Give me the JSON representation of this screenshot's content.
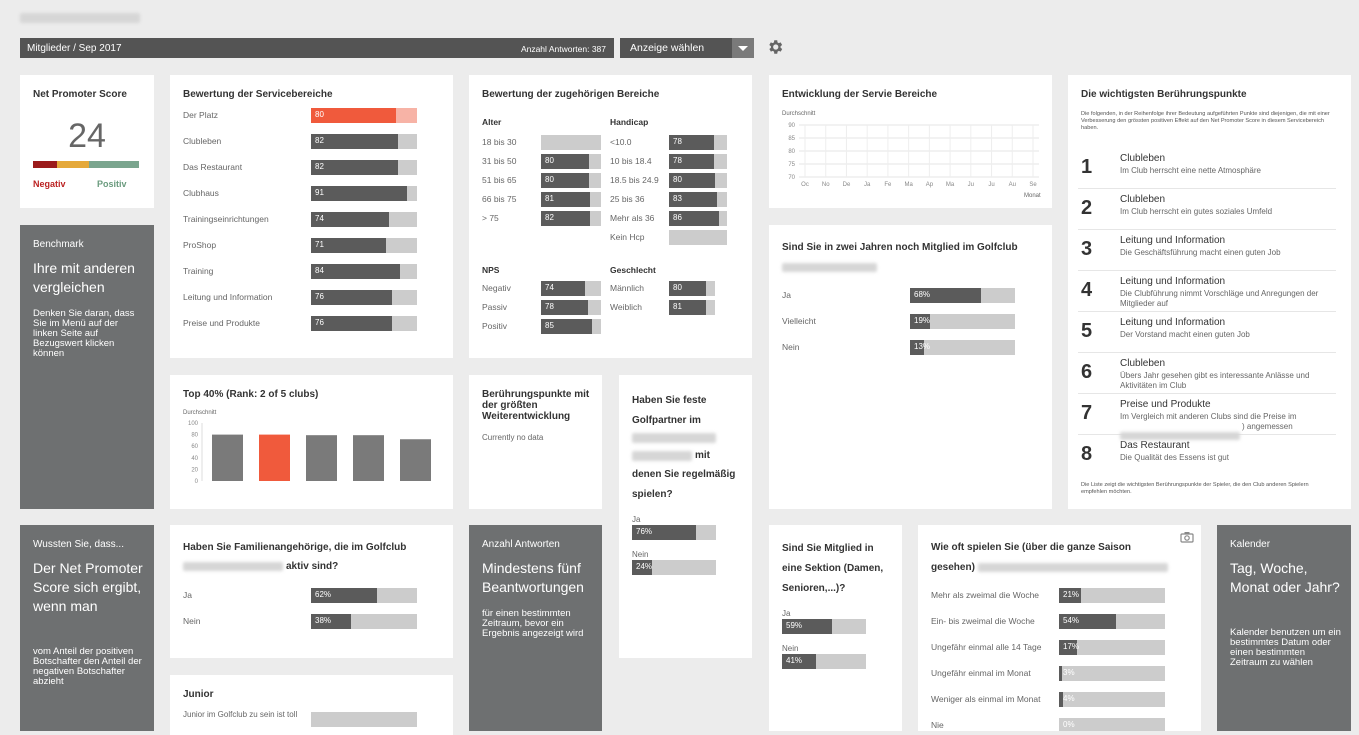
{
  "header": {
    "breadcrumb": "Mitglieder / Sep 2017",
    "answers": "Anzahl Antworten: 387",
    "select_label": "Anzeige wählen"
  },
  "nps": {
    "title": "Net Promoter Score",
    "value": "24",
    "neg": "Negativ",
    "pos": "Positiv"
  },
  "benchmark": {
    "title": "Benchmark",
    "headline": "Ihre mit anderen vergleichen",
    "text": "Denken Sie daran, dass Sie im Menü auf der linken Seite auf Bezugswert klicken können"
  },
  "service": {
    "title": "Bewertung der Servicebereiche",
    "items": [
      {
        "label": "Der Platz",
        "text": "80",
        "value": 80
      },
      {
        "label": "Clubleben",
        "text": "82",
        "value": 82
      },
      {
        "label": "Das Restaurant",
        "text": "82",
        "value": 82
      },
      {
        "label": "Clubhaus",
        "text": "91",
        "value": 91
      },
      {
        "label": "Trainingseinrichtungen",
        "text": "74",
        "value": 74
      },
      {
        "label": "ProShop",
        "text": "71",
        "value": 71
      },
      {
        "label": "Training",
        "text": "84",
        "value": 84
      },
      {
        "label": "Leitung und Information",
        "text": "76",
        "value": 76
      },
      {
        "label": "Preise und Produkte",
        "text": "76",
        "value": 76
      }
    ]
  },
  "related": {
    "title": "Bewertung der zugehörigen Bereiche",
    "alter_title": "Alter",
    "alter": [
      {
        "label": "18 bis 30",
        "text": "",
        "value": 0
      },
      {
        "label": "31 bis 50",
        "text": "80",
        "value": 80
      },
      {
        "label": "51 bis 65",
        "text": "80",
        "value": 80
      },
      {
        "label": "66 bis 75",
        "text": "81",
        "value": 81
      },
      {
        "label": "> 75",
        "text": "82",
        "value": 82
      }
    ],
    "hcp_title": "Handicap",
    "hcp": [
      {
        "label": "<10.0",
        "text": "78",
        "value": 78
      },
      {
        "label": "10 bis 18.4",
        "text": "78",
        "value": 78
      },
      {
        "label": "18.5 bis 24.9",
        "text": "80",
        "value": 80
      },
      {
        "label": "25 bis 36",
        "text": "83",
        "value": 83
      },
      {
        "label": "Mehr als 36",
        "text": "86",
        "value": 86
      },
      {
        "label": "Kein Hcp",
        "text": "",
        "value": 0
      }
    ],
    "nps_title": "NPS",
    "nps": [
      {
        "label": "Negativ",
        "text": "74",
        "value": 74
      },
      {
        "label": "Passiv",
        "text": "78",
        "value": 78
      },
      {
        "label": "Positiv",
        "text": "85",
        "value": 85
      }
    ],
    "gender_title": "Geschlecht",
    "gender": [
      {
        "label": "Männlich",
        "text": "80",
        "value": 80
      },
      {
        "label": "Weiblich",
        "text": "81",
        "value": 81
      }
    ]
  },
  "trend": {
    "title": "Entwicklung der Servie Bereiche",
    "ylabel": "Durchschnitt",
    "xlabel": "Monat",
    "yticks": [
      "90",
      "85",
      "80",
      "75",
      "70"
    ],
    "months": [
      "Oc",
      "No",
      "De",
      "Ja",
      "Fe",
      "Ma",
      "Ap",
      "Ma",
      "Ju",
      "Ju",
      "Au",
      "Se"
    ]
  },
  "touch": {
    "title": "Die wichtigsten Berührungspunkte",
    "intro": "Die folgenden, in der Reihenfolge ihrer Bedeutung aufgeführten Punkte sind diejenigen, die mit einer Verbesserung den grössten positiven Effekt auf den Net Promoter Score in diesem Servicebereich haben.",
    "items": [
      {
        "num": "1",
        "title": "Clubleben",
        "desc": "Im Club herrscht eine nette Atmosphäre"
      },
      {
        "num": "2",
        "title": "Clubleben",
        "desc": "Im Club herrscht ein gutes soziales Umfeld"
      },
      {
        "num": "3",
        "title": "Leitung und Information",
        "desc": "Die Geschäftsführung macht einen guten Job"
      },
      {
        "num": "4",
        "title": "Leitung und Information",
        "desc": "Die Clubführung nimmt Vorschläge und Anregungen der Mitglieder auf"
      },
      {
        "num": "5",
        "title": "Leitung und Information",
        "desc": "Der Vorstand macht einen guten Job"
      },
      {
        "num": "6",
        "title": "Clubleben",
        "desc": "Übers Jahr gesehen gibt es interessante Anlässe und Aktivitäten im Club"
      },
      {
        "num": "7",
        "title": "Preise und Produkte",
        "desc": "Im Vergleich mit anderen Clubs sind die Preise im",
        "desc2": ") angemessen"
      },
      {
        "num": "8",
        "title": "Das Restaurant",
        "desc": "Die Qualität des Essens ist gut"
      }
    ],
    "footer": "Die Liste zeigt die wichtigsten Berührungspunkte der Spieler, die den Club anderen Spielern empfehlen möchten."
  },
  "member2y": {
    "title": "Sind Sie in zwei Jahren noch Mitglied im Golfclub",
    "items": [
      {
        "label": "Ja",
        "text": "68%",
        "value": 68
      },
      {
        "label": "Vielleicht",
        "text": "19%",
        "value": 19
      },
      {
        "label": "Nein",
        "text": "13%",
        "value": 13
      }
    ]
  },
  "top": {
    "title": "Top 40% (Rank: 2 of 5 clubs)",
    "ylabel": "Durchschnitt",
    "yticks": [
      "100",
      "80",
      "60",
      "40",
      "20",
      "0"
    ]
  },
  "chart_data": {
    "type": "bar",
    "title": "Top 40% (Rank: 2 of 5 clubs)",
    "ylabel": "Durchschnitt",
    "ylim": [
      0,
      100
    ],
    "values": [
      80,
      80,
      79,
      79,
      72
    ],
    "colors": [
      "#7a7a7a",
      "#f05a3c",
      "#7a7a7a",
      "#7a7a7a",
      "#7a7a7a"
    ]
  },
  "touchdev": {
    "title": "Berührungspunkte mit der größten Weiterentwicklung",
    "text": "Currently no data"
  },
  "partner": {
    "title1": "Haben Sie feste Golfpartner im",
    "title2": "mit",
    "title3": "denen Sie regelmäßig spielen?",
    "items": [
      {
        "label": "Ja",
        "text": "76%",
        "value": 76
      },
      {
        "label": "Nein",
        "text": "24%",
        "value": 24
      }
    ]
  },
  "wussten": {
    "title": "Wussten Sie, dass...",
    "headline": "Der Net Promoter Score sich ergibt, wenn man",
    "text": "vom Anteil der positiven Botschafter den Anteil der negativen Botschafter abzieht"
  },
  "family": {
    "title": "Haben Sie Familienangehörige, die im Golfclub",
    "title2": "aktiv sind?",
    "items": [
      {
        "label": "Ja",
        "text": "62%",
        "value": 62
      },
      {
        "label": "Nein",
        "text": "38%",
        "value": 38
      }
    ]
  },
  "junior": {
    "title": "Junior",
    "label": "Junior im Golfclub zu sein ist toll"
  },
  "anzahl": {
    "title": "Anzahl Antworten",
    "headline": "Mindestens fünf Beantwortungen",
    "text": "für einen bestimmten Zeitraum, bevor ein Ergebnis angezeigt wird"
  },
  "section": {
    "title": "Sind Sie Mitglied in eine Sektion (Damen, Senioren,...)?",
    "items": [
      {
        "label": "Ja",
        "text": "59%",
        "value": 59
      },
      {
        "label": "Nein",
        "text": "41%",
        "value": 41
      }
    ]
  },
  "freq": {
    "title": "Wie oft spielen Sie (über die ganze Saison",
    "title2": "gesehen)",
    "items": [
      {
        "label": "Mehr als zweimal die Woche",
        "text": "21%",
        "value": 21
      },
      {
        "label": "Ein- bis zweimal die Woche",
        "text": "54%",
        "value": 54
      },
      {
        "label": "Ungefähr einmal alle 14 Tage",
        "text": "17%",
        "value": 17
      },
      {
        "label": "Ungefähr einmal im Monat",
        "text": "3%",
        "value": 3
      },
      {
        "label": "Weniger als einmal im Monat",
        "text": "4%",
        "value": 4
      },
      {
        "label": "Nie",
        "text": "0%",
        "value": 0
      }
    ]
  },
  "kalender": {
    "title": "Kalender",
    "headline": "Tag, Woche, Monat oder Jahr?",
    "text": "Kalender benutzen um ein bestimmtes Datum oder einen bestimmten Zeitraum zu wählen"
  }
}
